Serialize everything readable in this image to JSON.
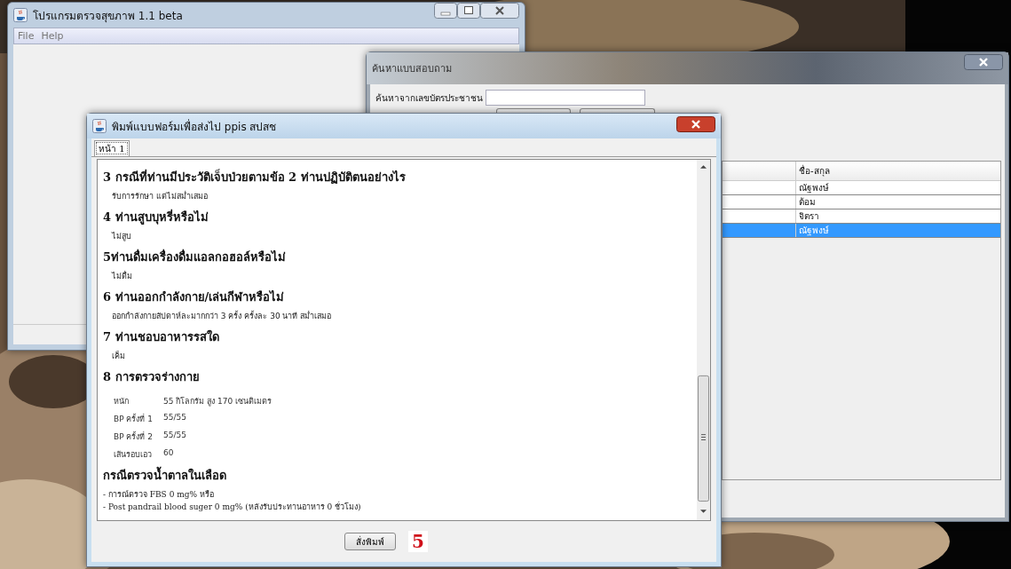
{
  "main_window": {
    "title": "โปรแกรมตรวจสุขภาพ 1.1 beta",
    "menu": [
      "File",
      "Help"
    ]
  },
  "search_window": {
    "title": "ค้นหาแบบสอบถาม",
    "search_label": "ค้นหาจากเลขบัตรประชาชน",
    "table": {
      "columns": [
        "ชื่อ-สกุล"
      ],
      "rows": [
        {
          "name": "ณัฐพงษ์",
          "selected": false
        },
        {
          "name": "ต้อม",
          "selected": false
        },
        {
          "name": "จิตรา",
          "selected": false
        },
        {
          "name": "ณัฐพงษ์",
          "selected": true
        }
      ]
    }
  },
  "print_dialog": {
    "title": "พิมพ์แบบฟอร์มเพื่อส่งไป  ppis สปสช",
    "tabs": [
      {
        "label": "หน้า 1",
        "selected": true
      }
    ],
    "sections": [
      {
        "heading": "3 กรณีที่ท่านมีประวัติเจ็บป่วยตามข้อ 2 ท่านปฏิบัติตนอย่างไร",
        "kind": "answer",
        "lines": [
          "รับการรักษา แต่ไม่สม่ำเสมอ"
        ]
      },
      {
        "heading": "4 ท่านสูบบุหรี่หรือไม่",
        "kind": "answer",
        "lines": [
          "ไม่สูบ"
        ]
      },
      {
        "heading": "5ท่านดื่มเครื่องดื่มแอลกอฮอล์หรือไม่",
        "kind": "answer",
        "lines": [
          "ไม่ดื่ม"
        ]
      },
      {
        "heading": "6 ท่านออกกำลังกาย/เล่นกีฬาหรือไม่",
        "kind": "answer",
        "lines": [
          "ออกกำลังกายสัปดาห์ละมากกว่า 3 ครั้ง ครั้งละ 30 นาที สม่ำเสมอ"
        ]
      },
      {
        "heading": "7 ท่านชอบอาหารรสใด",
        "kind": "answer",
        "lines": [
          "เค็ม"
        ]
      },
      {
        "heading": "8 การตรวจร่างกาย",
        "kind": "measures",
        "rows": [
          {
            "label": "หนัก",
            "value": "55  กิโลกรัม  สูง  170  เซนติเมตร"
          },
          {
            "label": "BP ครั้งที่ 1",
            "value": "55/55"
          },
          {
            "label": "BP ครั้งที่ 2",
            "value": "55/55"
          },
          {
            "label": "เส้นรอบเอว",
            "value": "60"
          }
        ]
      },
      {
        "heading": "กรณีตรวจน้ำตาลในเลือด",
        "kind": "note",
        "lines": [
          "- การณ์ตรวจ FBS 0  mg% หรือ",
          "- Post pandrail blood suger 0  mg% (หลังรับประทานอาหาร  0  ชั่วโมง)"
        ]
      }
    ],
    "print_button": "สั่งพิมพ์",
    "page_count": "5"
  }
}
